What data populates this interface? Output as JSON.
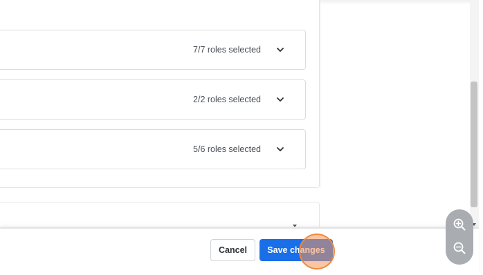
{
  "role_rows": [
    {
      "count_label": "7/7 roles selected"
    },
    {
      "count_label": "2/2 roles selected"
    },
    {
      "count_label": "5/6 roles selected"
    }
  ],
  "footer": {
    "cancel_label": "Cancel",
    "save_label": "Save changes"
  },
  "zoom": {
    "zoom_in_icon": "zoom-in-icon",
    "zoom_out_icon": "zoom-out-icon"
  },
  "colors": {
    "primary": "#1a6fe8",
    "click_indicator": "#f08a3c",
    "zoom_control": "#a9adb2"
  }
}
